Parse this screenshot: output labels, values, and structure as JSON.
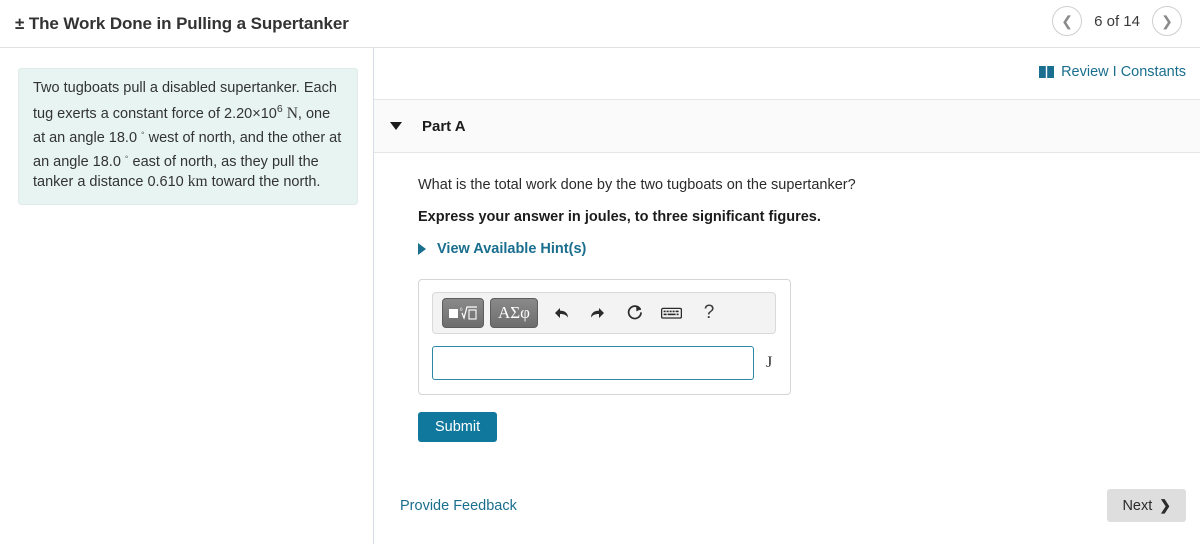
{
  "header": {
    "title": "± The Work Done in Pulling a Supertanker",
    "prev_icon": "chevron-left-icon",
    "next_icon": "chevron-right-icon",
    "page_indicator": "6 of 14"
  },
  "problem": {
    "text_part1": "Two tugboats pull a disabled supertanker. Each tug exerts a constant force of 2.20×10",
    "exponent": "6",
    "unit_force": "N",
    "text_part2": ", one at an angle 18.0",
    "degree1": "◦",
    "text_part3": "west of north, and the other at an angle 18.0",
    "degree2": "◦",
    "text_part4": "east of north, as they pull the tanker a distance 0.610",
    "unit_distance": "km",
    "text_part5": "toward the north."
  },
  "review": {
    "icon": "book-icon",
    "label": "Review I Constants",
    "color": "#1a6e8e"
  },
  "part": {
    "caret_icon": "caret-down-icon",
    "label": "Part A",
    "question": "What is the total work done by the two tugboats on the supertanker?",
    "instruction": "Express your answer in joules, to three significant figures.",
    "hints_caret_icon": "caret-right-icon",
    "hints_label": "View Available Hint(s)"
  },
  "answer_widget": {
    "toolbar": [
      {
        "name": "math-template-button",
        "glyph": "template",
        "kind": "button"
      },
      {
        "name": "greek-symbols-button",
        "glyph": "ΑΣφ",
        "kind": "button"
      },
      {
        "name": "undo-icon",
        "glyph": "↶",
        "kind": "icon"
      },
      {
        "name": "redo-icon",
        "glyph": "↷",
        "kind": "icon"
      },
      {
        "name": "reset-icon",
        "glyph": "↺",
        "kind": "icon"
      },
      {
        "name": "keyboard-icon",
        "glyph": "⌨",
        "kind": "icon"
      },
      {
        "name": "help-icon",
        "glyph": "?",
        "kind": "icon"
      }
    ],
    "input_value": "",
    "input_placeholder": "",
    "unit_label": "J",
    "border_color": "#2d88a8"
  },
  "submit": {
    "label": "Submit",
    "color": "#10789d"
  },
  "footer": {
    "feedback_label": "Provide Feedback",
    "next_label": "Next",
    "next_chevron": "❯"
  }
}
